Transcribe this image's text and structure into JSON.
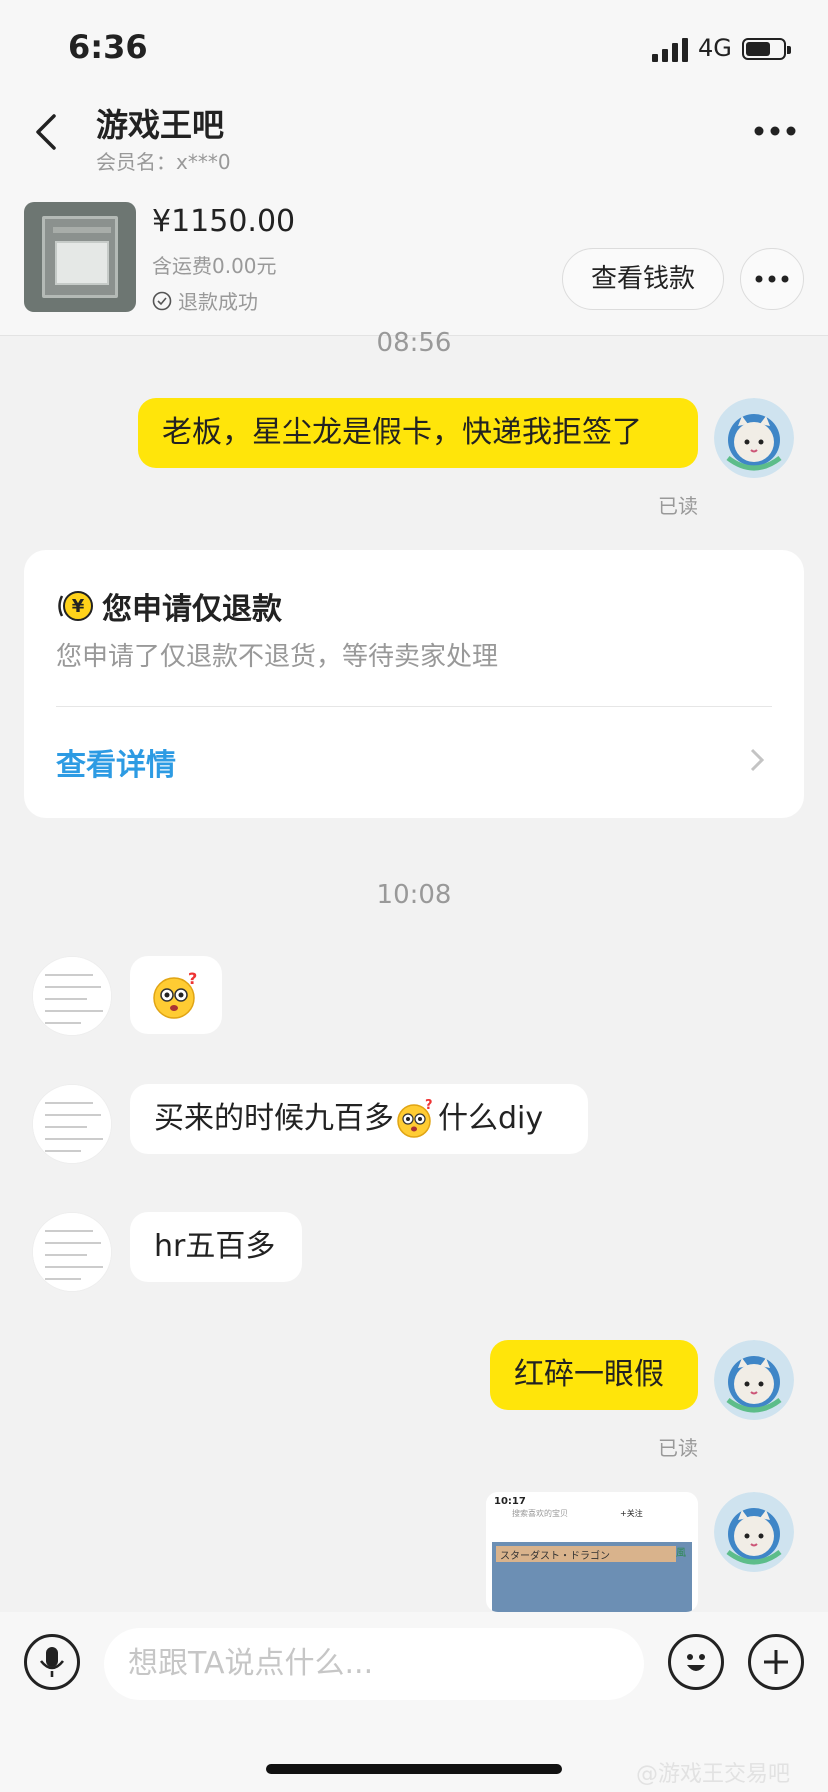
{
  "status_bar": {
    "time": "6:36",
    "network": "4G"
  },
  "header": {
    "title": "游戏王吧",
    "member_label": "会员名：x***0"
  },
  "product": {
    "price": "¥1150.00",
    "shipping": "含运费0.00元",
    "refund_status": "退款成功",
    "view_money_label": "查看钱款"
  },
  "messages": {
    "time_1": "08:56",
    "msg_1": "老板，星尘龙是假卡，快递我拒签了",
    "read_label": "已读",
    "refund_card": {
      "title": "您申请仅退款",
      "subtitle": "您申请了仅退款不退货，等待卖家处理",
      "link": "查看详情"
    },
    "time_2": "10:08",
    "msg_3_part1": "买来的时候九百多",
    "msg_3_part2": "什么diy",
    "msg_4": "hr五百多",
    "msg_5": "红碎一眼假",
    "screenshot": {
      "time": "10:17",
      "search_placeholder": "搜索喜欢的宝贝",
      "follow": "+关注",
      "card_name": "スターダスト・ドラゴン",
      "attribute": "風"
    }
  },
  "input_bar": {
    "placeholder": "想跟TA说点什么..."
  },
  "watermark": "@游戏王交易吧",
  "colors": {
    "accent_yellow": "#ffe50a",
    "link_blue": "#2d9be3",
    "background": "#f2f2f2"
  }
}
